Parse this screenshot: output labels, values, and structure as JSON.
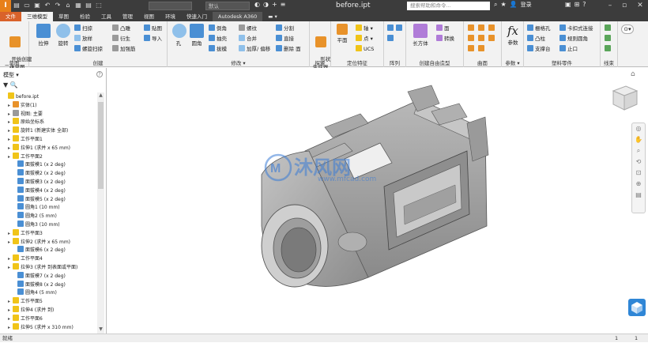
{
  "titlebar": {
    "logo": "I",
    "style_combo": "默认",
    "material_combo": "默认",
    "document_title": "before.ipt",
    "search_placeholder": "搜索帮助和命令...",
    "login_label": "登录",
    "help_label": "?"
  },
  "tabs": [
    "文件",
    "三维模型",
    "草图",
    "检验",
    "工具",
    "管理",
    "视图",
    "环境",
    "快速入门",
    "Autodesk A360"
  ],
  "ribbon": {
    "panels": {
      "sketch": {
        "title": "草图",
        "button": "开始创建\n二维草图"
      },
      "create": {
        "title": "创建",
        "extrude": "拉伸",
        "revolve": "旋转",
        "sweep": "扫掠",
        "loft": "放样",
        "coil": "螺旋扫掠",
        "emboss": "凸雕",
        "derive": "衍生",
        "rib": "加强筋",
        "decal": "贴图",
        "import": "导入"
      },
      "modify": {
        "title": "修改 ▾",
        "hole": "孔",
        "fillet": "圆角",
        "chamfer": "倒角",
        "shell": "抽壳",
        "draft": "拔模",
        "thread": "螺纹",
        "combine": "合并",
        "thicken": "加厚/ 偏移",
        "split": "分割",
        "direct": "直接",
        "delete_face": "删除 面"
      },
      "explore": {
        "title": "探索",
        "shape_gen": "形状\n生成器"
      },
      "work": {
        "title": "定位特征",
        "plane": "平面",
        "axis": "轴 ▾",
        "point": "点 ▾",
        "ucs": "UCS"
      },
      "pattern": {
        "title": "阵列"
      },
      "freeform": {
        "title": "创建自由造型",
        "box": "长方体",
        "face": "面",
        "convert": "转换"
      },
      "surface": {
        "title": "曲面"
      },
      "params": {
        "title": "参数 ▾",
        "fx": "参数"
      },
      "plastic": {
        "title": "塑料零件",
        "grill": "栅格孔",
        "boss": "凸柱",
        "rest": "支撑台",
        "snap": "卡扣式连接",
        "rule_fillet": "规则圆角",
        "lip": "止口"
      },
      "harness": {
        "title": "线束"
      }
    }
  },
  "browser": {
    "header": "模型 ▾",
    "help": "?",
    "tools": "▼ 🔍",
    "items": [
      {
        "label": "before.ipt",
        "icon": "part",
        "indent": 0
      },
      {
        "label": "实体(1)",
        "icon": "solid",
        "indent": 1
      },
      {
        "label": "视图: 主要",
        "icon": "view",
        "indent": 1
      },
      {
        "label": "原始坐标系",
        "icon": "folder",
        "indent": 1
      },
      {
        "label": "旋转1 (新建实体 全部)",
        "icon": "feature",
        "indent": 1
      },
      {
        "label": "工作平面1",
        "icon": "plane",
        "indent": 1
      },
      {
        "label": "拉伸1 (求并 x 65 mm)",
        "icon": "feature",
        "indent": 1
      },
      {
        "label": "工作平面2",
        "icon": "plane",
        "indent": 1
      },
      {
        "label": "面拔模1 (x 2 deg)",
        "icon": "draft",
        "indent": 2
      },
      {
        "label": "面拔模2 (x 2 deg)",
        "icon": "draft",
        "indent": 2
      },
      {
        "label": "面拔模3 (x 2 deg)",
        "icon": "draft",
        "indent": 2
      },
      {
        "label": "面拔模4 (x 2 deg)",
        "icon": "draft",
        "indent": 2
      },
      {
        "label": "面拔模5 (x 2 deg)",
        "icon": "draft",
        "indent": 2
      },
      {
        "label": "圆角1 (10 mm)",
        "icon": "fillet",
        "indent": 2
      },
      {
        "label": "圆角2 (5 mm)",
        "icon": "fillet",
        "indent": 2
      },
      {
        "label": "圆角3 (10 mm)",
        "icon": "fillet",
        "indent": 2
      },
      {
        "label": "工作平面3",
        "icon": "plane",
        "indent": 1
      },
      {
        "label": "拉伸2 (求并 x 65 mm)",
        "icon": "feature",
        "indent": 1
      },
      {
        "label": "面拔模6 (x 2 deg)",
        "icon": "draft",
        "indent": 2
      },
      {
        "label": "工作平面4",
        "icon": "plane",
        "indent": 1
      },
      {
        "label": "拉伸3 (求并 到表面或平面)",
        "icon": "feature",
        "indent": 1
      },
      {
        "label": "面拔模7 (x 2 deg)",
        "icon": "draft",
        "indent": 2
      },
      {
        "label": "面拔模8 (x 2 deg)",
        "icon": "draft",
        "indent": 2
      },
      {
        "label": "圆角4 (5 mm)",
        "icon": "fillet",
        "indent": 2
      },
      {
        "label": "工作平面5",
        "icon": "plane",
        "indent": 1
      },
      {
        "label": "拉伸4 (求并 到)",
        "icon": "feature",
        "indent": 1
      },
      {
        "label": "工作平面6",
        "icon": "plane",
        "indent": 1
      },
      {
        "label": "拉伸5 (求并 x 310 mm)",
        "icon": "feature",
        "indent": 1
      }
    ]
  },
  "viewport": {
    "watermark_text": "沐风网",
    "watermark_url": "www.mfcad.com",
    "viewcube_label": "ViewCube"
  },
  "status": {
    "left": "就绪",
    "num1": "1",
    "num2": "1"
  },
  "colors": {
    "accent": "#d9622a",
    "titlebar": "#3c3c3c",
    "ribbon": "#f2f2f2",
    "model": "#a9a9a9"
  }
}
